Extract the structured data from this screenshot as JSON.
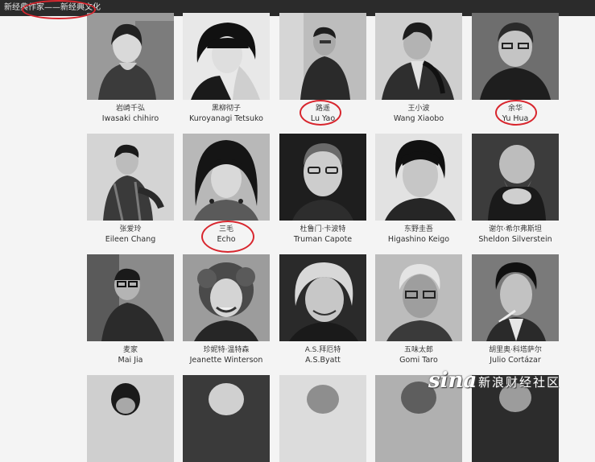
{
  "breadcrumb": "新经典作家——新经典文化",
  "authors": [
    {
      "cn": "岩崎千弘",
      "en": "Iwasaki chihiro"
    },
    {
      "cn": "黑柳彻子",
      "en": "Kuroyanagi Tetsuko"
    },
    {
      "cn": "路遥",
      "en": "Lu Yao"
    },
    {
      "cn": "王小波",
      "en": "Wang Xiaobo"
    },
    {
      "cn": "余华",
      "en": "Yu Hua"
    },
    {
      "cn": "张爱玲",
      "en": "Eileen Chang"
    },
    {
      "cn": "三毛",
      "en": "Echo"
    },
    {
      "cn": "杜鲁门·卡波特",
      "en": "Truman Capote"
    },
    {
      "cn": "东野圭吾",
      "en": "Higashino Keigo"
    },
    {
      "cn": "谢尔·希尔弗斯坦",
      "en": "Sheldon Silverstein"
    },
    {
      "cn": "麦家",
      "en": "Mai Jia"
    },
    {
      "cn": "珍妮特·温特森",
      "en": "Jeanette Winterson"
    },
    {
      "cn": "A.S.拜厄特",
      "en": "A.S.Byatt"
    },
    {
      "cn": "五味太郎",
      "en": "Gomi Taro"
    },
    {
      "cn": "胡里奥·科塔萨尔",
      "en": "Julio Cortázar"
    }
  ],
  "watermark": {
    "logo": "sina",
    "text": "新浪财经社区"
  }
}
